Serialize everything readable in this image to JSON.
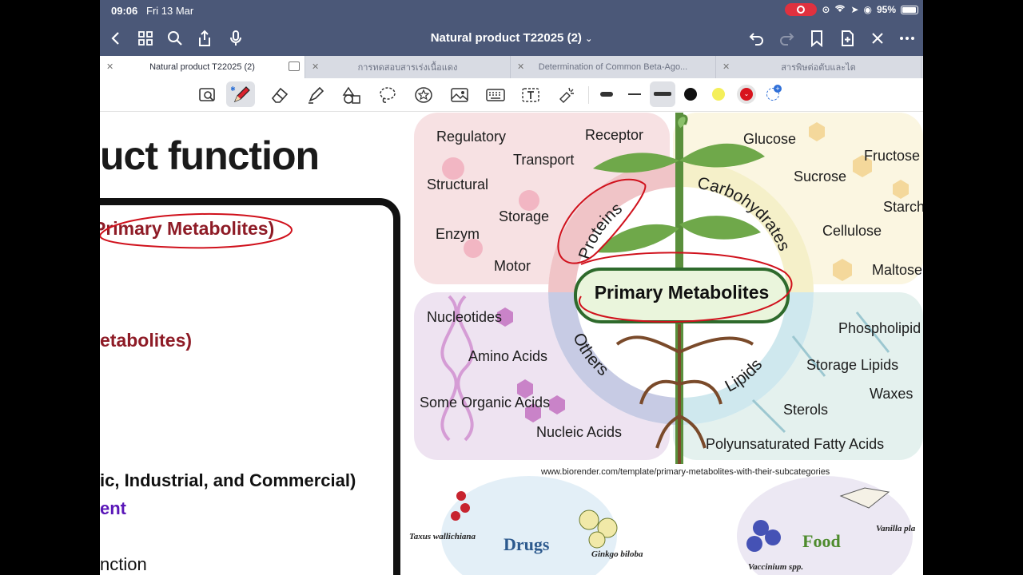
{
  "status": {
    "time": "09:06",
    "date": "Fri 13 Mar",
    "battery": "95%"
  },
  "nav": {
    "title": "Natural product T22025 (2)",
    "title_chevron": "⌄"
  },
  "tabs": [
    {
      "label": "Natural product T22025 (2)",
      "active": true
    },
    {
      "label": "การทดสอบสารเร่งเนื้อแดง",
      "active": false
    },
    {
      "label": "Determination of Common Beta-Ago...",
      "active": false
    },
    {
      "label": "สารพิษต่อตับและไต",
      "active": false
    }
  ],
  "colors": {
    "topbar": "#4b5878",
    "accent_red": "#e0313f",
    "heading_red": "#8e1b26",
    "heading_purple": "#5a17b8"
  },
  "slide": {
    "title": "uct function",
    "head1": "Primary Metabolites)",
    "head2": "etabolites)",
    "head3": "ic, Industrial, and Commercial)",
    "head4": "ent",
    "line_last": "nction"
  },
  "figure": {
    "center": "Primary Metabolites",
    "proteins": "Proteins",
    "carbohydrates": "Carbohydrates",
    "others": "Others",
    "lipids": "Lipids",
    "protein_items": [
      "Regulatory",
      "Receptor",
      "Transport",
      "Structural",
      "Storage",
      "Enzym",
      "Motor"
    ],
    "carb_items": [
      "Glucose",
      "Fructose",
      "Sucrose",
      "Starch",
      "Cellulose",
      "Maltose"
    ],
    "other_items": [
      "Nucleotides",
      "Amino Acids",
      "Some Organic Acids",
      "Nucleic Acids"
    ],
    "lipid_items": [
      "Phospholipid",
      "Storage Lipids",
      "Waxes",
      "Sterols",
      "Polyunsaturated Fatty Acids"
    ],
    "credit": "www.biorender.com/template/primary-metabolites-with-their-subcategories",
    "bottom": {
      "taxus": "Taxus wallichiana",
      "drugs": "Drugs",
      "ginkgo": "Ginkgo biloba",
      "vaccinium": "Vaccinium spp.",
      "food": "Food",
      "vanilla": "Vanilla pla"
    }
  }
}
